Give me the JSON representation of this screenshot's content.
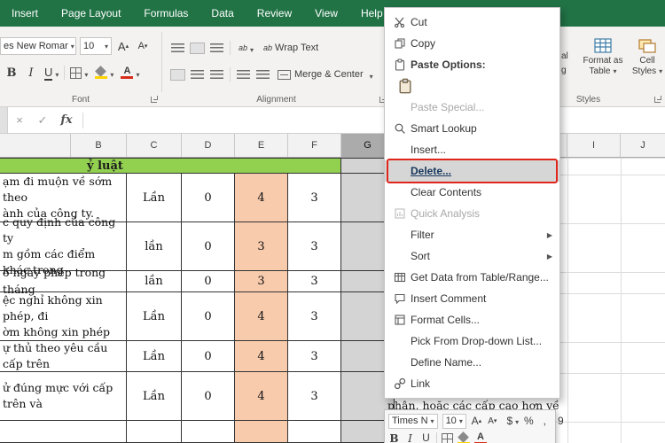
{
  "ribbon": {
    "tabs": [
      {
        "label": "Insert"
      },
      {
        "label": "Page Layout"
      },
      {
        "label": "Formulas"
      },
      {
        "label": "Data"
      },
      {
        "label": "Review"
      },
      {
        "label": "View"
      },
      {
        "label": "Help"
      }
    ],
    "font": {
      "name_value": "es New Romar",
      "size_value": "10",
      "bold": "B",
      "italic": "I",
      "underline": "U",
      "grow": "A",
      "shrink": "A",
      "label": "Font"
    },
    "alignment": {
      "ab": "ab",
      "wrap_text": "Wrap Text",
      "merge_center": "Merge & Center",
      "label": "Alignment"
    },
    "styles": {
      "conditional_cut_line1": "al",
      "conditional_cut_line2": "g",
      "format_as_table_line1": "Format as",
      "format_as_table_line2": "Table",
      "cell_styles_line1": "Cell",
      "cell_styles_line2": "Styles",
      "label": "Styles"
    }
  },
  "formula_bar": {
    "cancel": "×",
    "enter": "✓",
    "fx": "fx"
  },
  "sheet": {
    "columns": [
      "B",
      "C",
      "D",
      "E",
      "F",
      "G",
      "I",
      "J"
    ],
    "selected_column": "G",
    "section_header": "ỷ luật",
    "rows": [
      {
        "line1": "ạm đi muộn về sớm theo",
        "line2": "ành của công ty.",
        "unit": "Lần",
        "freq": "0",
        "score": "4",
        "max": "3"
      },
      {
        "line1": "c quy định của công ty",
        "line2": "m gồm các điểm khác trong",
        "unit": "lần",
        "freq": "0",
        "score": "3",
        "max": "3"
      },
      {
        "line1": "ố ngày phép trong tháng",
        "line2": "",
        "unit": "lần",
        "freq": "0",
        "score": "3",
        "max": "3"
      },
      {
        "line1": "ệc nghỉ không xin phép, đi",
        "line2": "ờm không xin phép",
        "unit": "Lần",
        "freq": "0",
        "score": "4",
        "max": "3"
      },
      {
        "line1": "ự thủ theo yêu cầu cấp trên",
        "line2": "",
        "unit": "Lần",
        "freq": "0",
        "score": "4",
        "max": "3"
      },
      {
        "line1": "ử đúng mực với cấp trên và",
        "line2": "",
        "unit": "Lần",
        "freq": "0",
        "score": "4",
        "max": "3"
      }
    ],
    "behind_text": "phận, hoặc các cấp cao hơn về thái",
    "colors": {
      "ribbon_green": "#217346",
      "section_green": "#92D050",
      "col_e_fill": "#F8CBAD",
      "selection_gray": "#D4D4D4",
      "annotation_red": "#E0261C"
    }
  },
  "context_menu": {
    "items": [
      {
        "label": "Cut"
      },
      {
        "label": "Copy"
      },
      {
        "label": "Paste Options:"
      },
      {
        "label": ""
      },
      {
        "label": "Paste Special...",
        "disabled": true
      },
      {
        "label": "Smart Lookup"
      },
      {
        "label": "Insert..."
      },
      {
        "label": "Delete...",
        "highlighted": true
      },
      {
        "label": "Clear Contents"
      },
      {
        "label": "Quick Analysis",
        "disabled": true
      },
      {
        "label": "Filter",
        "submenu": true
      },
      {
        "label": "Sort",
        "submenu": true
      },
      {
        "label": "Get Data from Table/Range..."
      },
      {
        "label": "Insert Comment"
      },
      {
        "label": "Format Cells..."
      },
      {
        "label": "Pick From Drop-down List..."
      },
      {
        "label": "Define Name..."
      },
      {
        "label": "Link"
      }
    ]
  },
  "mini_toolbar": {
    "font_name": "Times N",
    "font_size": "10",
    "grow": "A",
    "shrink": "A",
    "currency": "$",
    "percent": "%",
    "comma": ",",
    "decimal": "9",
    "bold": "B",
    "italic": "I",
    "underline": "U"
  }
}
